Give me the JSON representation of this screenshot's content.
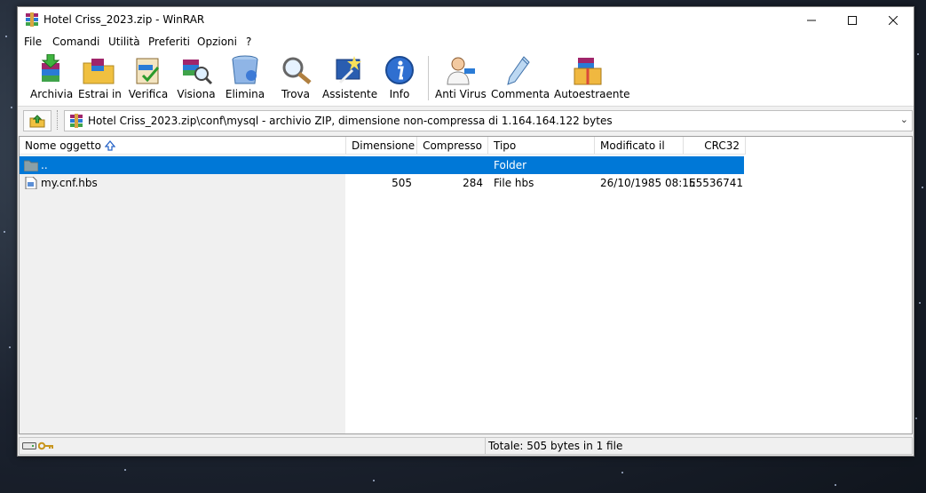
{
  "window": {
    "title": "Hotel Criss_2023.zip - WinRAR"
  },
  "menu": [
    "File",
    "Comandi",
    "Utilità",
    "Preferiti",
    "Opzioni",
    "?"
  ],
  "toolbar": [
    {
      "label": "Archivia",
      "icon": "archive-books-icon"
    },
    {
      "label": "Estrai in",
      "icon": "extract-folder-icon"
    },
    {
      "label": "Verifica",
      "icon": "test-clipboard-icon"
    },
    {
      "label": "Visiona",
      "icon": "view-magnifier-icon"
    },
    {
      "label": "Elimina",
      "icon": "trash-bin-icon"
    },
    {
      "label": "Trova",
      "icon": "find-magnifier-icon"
    },
    {
      "label": "Assistente",
      "icon": "wizard-icon"
    },
    {
      "label": "Info",
      "icon": "info-icon"
    },
    {
      "label": "Anti Virus",
      "icon": "doctor-icon"
    },
    {
      "label": "Commenta",
      "icon": "pen-icon"
    },
    {
      "label": "Autoestraente",
      "icon": "sfx-box-icon"
    }
  ],
  "address": {
    "path": "Hotel Criss_2023.zip\\conf\\mysql - archivio ZIP, dimensione non-compressa di 1.164.164.122 bytes"
  },
  "columns": [
    "Nome oggetto",
    "Dimensione",
    "Compresso",
    "Tipo",
    "Modificato il",
    "CRC32"
  ],
  "rows": [
    {
      "name": "..",
      "size": "",
      "packed": "",
      "type": "Folder",
      "modified": "",
      "crc": "",
      "icon": "folder-icon",
      "selected": true
    },
    {
      "name": "my.cnf.hbs",
      "size": "505",
      "packed": "284",
      "type": "File hbs",
      "modified": "26/10/1985 08:15",
      "crc": "E5536741",
      "icon": "file-icon",
      "selected": false
    }
  ],
  "status": {
    "total": "Totale: 505 bytes in 1 file"
  },
  "colors": {
    "selection": "#0078d7",
    "window_bg": "#f0f0f0"
  }
}
